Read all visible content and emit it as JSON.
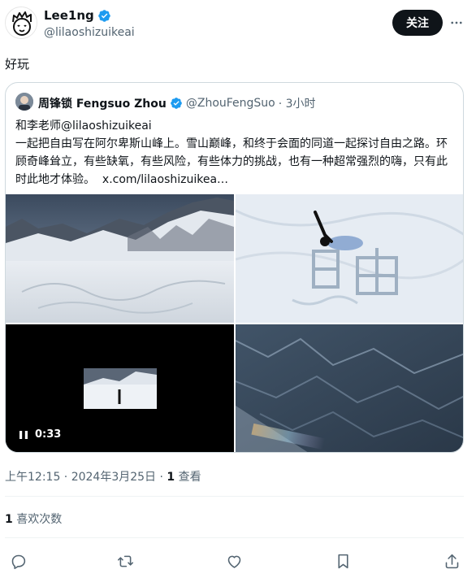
{
  "tweet": {
    "author_name": "Lee1ng",
    "author_handle": "@lilaoshizuikeai",
    "follow_label": "关注",
    "text": "好玩",
    "timestamp": "上午12:15 · 2024年3月25日 ·",
    "views_count": "1",
    "views_label": "查看",
    "likes_count": "1",
    "likes_label": "喜欢次数"
  },
  "quote": {
    "author_name": "周锋锁 Fengsuo Zhou",
    "author_handle": "@ZhouFengSuo",
    "time": "· 3小时",
    "text": "和李老师@lilaoshizuikeai\n一起把自由写在阿尔卑斯山峰上。雪山巅峰，和终于会面的同道一起探讨自由之路。环顾奇峰耸立，有些缺氧，有些风险，有些体力的挑战，也有一种超常强烈的嗨，只有此时此地才体验。",
    "link": "x.com/lilaoshizuikea…",
    "video_duration": "0:33"
  },
  "icons": {
    "verified": "verified-badge-icon",
    "more": "more-icon",
    "reply": "reply-icon",
    "retweet": "retweet-icon",
    "like": "like-icon",
    "bookmark": "bookmark-icon",
    "share": "share-icon",
    "pause": "pause-icon"
  },
  "colors": {
    "verified": "#1d9bf0",
    "text": "#0f1419",
    "muted": "#536471",
    "border": "#cfd9de"
  }
}
